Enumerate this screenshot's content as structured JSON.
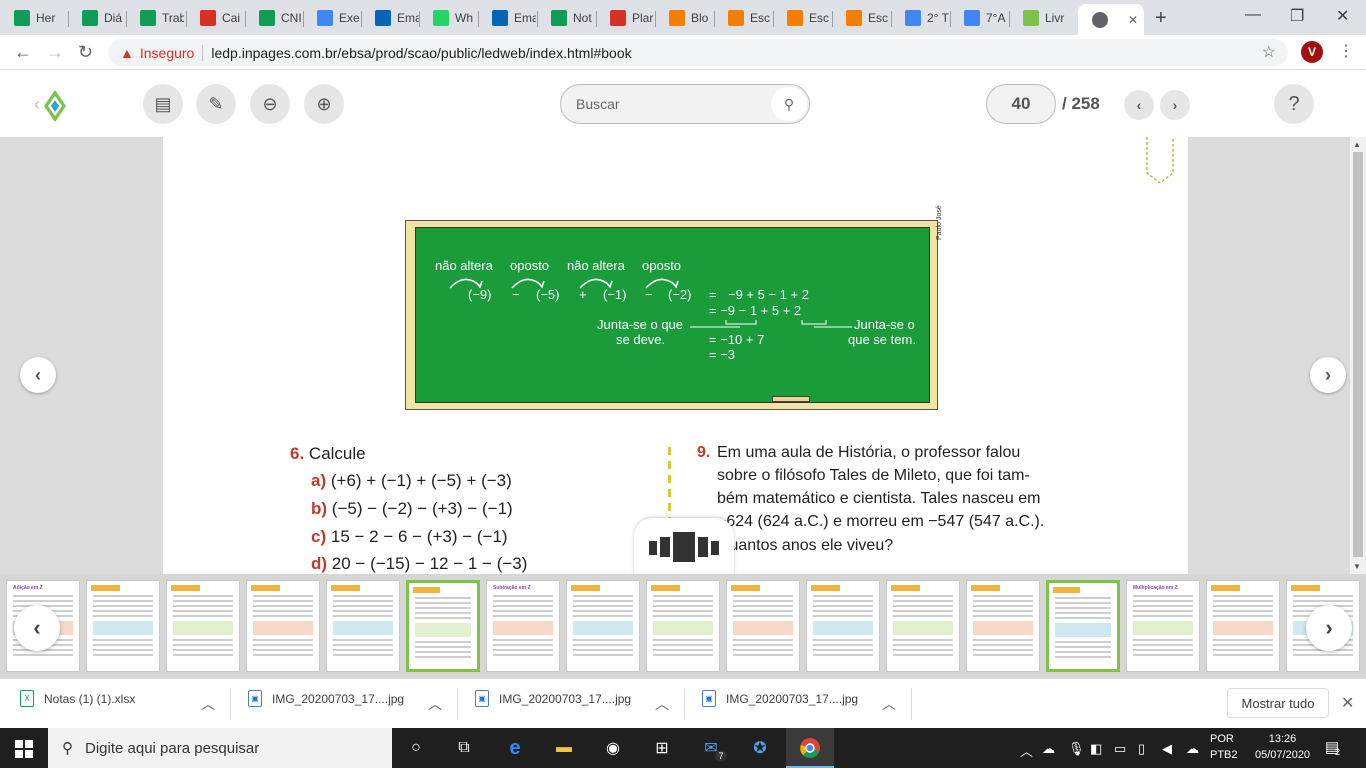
{
  "browser": {
    "tabs": [
      {
        "label": "Her",
        "icon": "sheets-icon",
        "color": "#0f9d58"
      },
      {
        "label": "Diá",
        "icon": "sheets-icon",
        "color": "#0f9d58"
      },
      {
        "label": "Trab",
        "icon": "sheets-icon",
        "color": "#0f9d58"
      },
      {
        "label": "Cai",
        "icon": "gmail-icon",
        "color": "#d93025"
      },
      {
        "label": "CNI",
        "icon": "sheets-icon",
        "color": "#0f9d58"
      },
      {
        "label": "Exe",
        "icon": "docs-icon",
        "color": "#4285f4"
      },
      {
        "label": "Ema",
        "icon": "outlook-icon",
        "color": "#0364b8"
      },
      {
        "label": "Wh",
        "icon": "whatsapp-icon",
        "color": "#25d366"
      },
      {
        "label": "Ema",
        "icon": "outlook-icon",
        "color": "#0364b8"
      },
      {
        "label": "Not",
        "icon": "sheets-icon",
        "color": "#0f9d58"
      },
      {
        "label": "Plar",
        "icon": "gmail-icon",
        "color": "#d93025"
      },
      {
        "label": "Blo",
        "icon": "blogger-icon",
        "color": "#f57d00"
      },
      {
        "label": "Esc",
        "icon": "blogger-icon",
        "color": "#f57d00"
      },
      {
        "label": "Esc",
        "icon": "blogger-icon",
        "color": "#f57d00"
      },
      {
        "label": "Esc",
        "icon": "blogger-icon",
        "color": "#f57d00"
      },
      {
        "label": "2° T",
        "icon": "docs-icon",
        "color": "#4285f4"
      },
      {
        "label": "7°A",
        "icon": "docs-icon",
        "color": "#4285f4"
      },
      {
        "label": "Livr",
        "icon": "book-reader-icon",
        "color": "#7dc34a"
      }
    ],
    "new_tab": "+",
    "controls": {
      "minimize": "—",
      "maximize": "❐",
      "close": "✕"
    },
    "security_label": "Inseguro",
    "url": "ledp.inpages.com.br/ebsa/prod/scao/public/ledweb/index.html#book",
    "avatar_initial": "V"
  },
  "reader": {
    "search_placeholder": "Buscar",
    "current_page": "40",
    "total_pages": "/ 258",
    "help": "?"
  },
  "board": {
    "labels": [
      "não altera",
      "oposto",
      "não altera",
      "oposto"
    ],
    "row1": [
      "(−9)",
      "−",
      "(−5)",
      "+",
      "(−1)",
      "−",
      "(−2)",
      "=",
      "−9 + 5 − 1 + 2"
    ],
    "row2": "=  −9 − 1 + 5 + 2",
    "left_note_1": "Junta-se o que",
    "left_note_2": "se deve.",
    "right_note_1": "Junta-se o",
    "right_note_2": "que se tem.",
    "row3": "=  −10 + 7",
    "row4": "=  −3",
    "credit": "Paulo José"
  },
  "exercise6": {
    "number": "6.",
    "title": "Calcule",
    "items": [
      {
        "letter": "a)",
        "text": "(+6) + (−1) + (−5) + (−3)"
      },
      {
        "letter": "b)",
        "text": "(−5) − (−2) − (+3) − (−1)"
      },
      {
        "letter": "c)",
        "text": "15 − 2 − 6 − (+3) − (−1)"
      },
      {
        "letter": "d)",
        "text": "20 − (−15) − 12 − 1 − (−3)"
      }
    ]
  },
  "exercise9": {
    "number": "9.",
    "lines": [
      "Em uma aula de História, o professor falou",
      "sobre o filósofo Tales de Mileto, que foi tam-",
      "bém matemático e cientista. Tales nasceu em",
      "−624 (624 a.C.) e morreu em −547 (547 a.C.).",
      "Quantos anos ele viveu?"
    ]
  },
  "thumbnails": [
    {
      "title": "Adição em Z",
      "selected": false
    },
    {
      "title": "",
      "selected": false
    },
    {
      "title": "",
      "selected": false
    },
    {
      "title": "",
      "selected": false
    },
    {
      "title": "",
      "selected": false
    },
    {
      "title": "",
      "selected": true
    },
    {
      "title": "Subtração em Z",
      "selected": false
    },
    {
      "title": "",
      "selected": false
    },
    {
      "title": "",
      "selected": false
    },
    {
      "title": "",
      "selected": false
    },
    {
      "title": "",
      "selected": false
    },
    {
      "title": "",
      "selected": false
    },
    {
      "title": "",
      "selected": false
    },
    {
      "title": "",
      "selected": true
    },
    {
      "title": "Multiplicação em Z",
      "selected": false
    },
    {
      "title": "",
      "selected": false
    },
    {
      "title": "",
      "selected": false
    }
  ],
  "downloads": {
    "items": [
      "Notas (1) (1).xlsx",
      "IMG_20200703_17....jpg",
      "IMG_20200703_17....jpg",
      "IMG_20200703_17....jpg"
    ],
    "show_all": "Mostrar tudo"
  },
  "taskbar": {
    "search_placeholder": "Digite aqui para pesquisar",
    "mail_badge": "7",
    "lang_1": "POR",
    "lang_2": "PTB2",
    "time": "13:26",
    "date": "05/07/2020",
    "notifications": "2"
  }
}
